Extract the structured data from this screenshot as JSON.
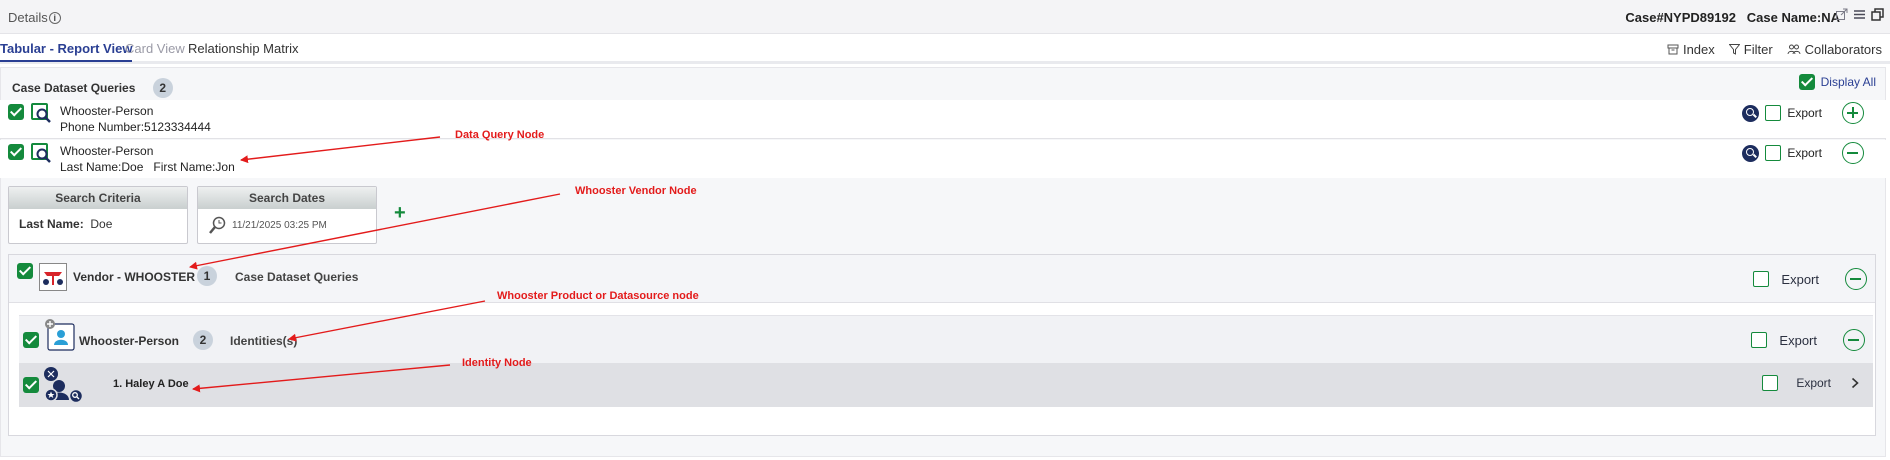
{
  "header": {
    "title": "Details",
    "case_label": "Case#NYPD89192",
    "case_name_label": "Case Name:",
    "case_name_value": "NA"
  },
  "tabs": [
    {
      "label": "Tabular - Report View",
      "state": "active"
    },
    {
      "label": "Card View",
      "state": "disabled"
    },
    {
      "label": "Relationship Matrix",
      "state": "normal"
    }
  ],
  "toolbar": {
    "index_label": "Index",
    "filter_label": "Filter",
    "collaborators_label": "Collaborators"
  },
  "dataset": {
    "title": "Case Dataset Queries",
    "count": "2",
    "display_all_label": "Display All"
  },
  "queries": [
    {
      "name": "Whooster-Person",
      "detail_label": "Phone Number:",
      "detail_value": "5123334444",
      "export_label": "Export"
    },
    {
      "name": "Whooster-Person",
      "detail_label": "Last Name:",
      "detail_value": "Doe",
      "detail2_label": "First Name:",
      "detail2_value": "Jon",
      "export_label": "Export"
    }
  ],
  "search_criteria": {
    "title": "Search Criteria",
    "field_label": "Last Name:",
    "field_value": "Doe"
  },
  "search_dates": {
    "title": "Search Dates",
    "value": "11/21/2025 03:25 PM"
  },
  "vendor": {
    "name": "Vendor - WHOOSTER",
    "count": "1",
    "label": "Case Dataset Queries",
    "export_label": "Export"
  },
  "product": {
    "name": "Whooster-Person",
    "count": "2",
    "label": "Identities(s)",
    "export_label": "Export"
  },
  "identity": {
    "name": "1. Haley A Doe",
    "export_label": "Export"
  },
  "annotations": {
    "data_query_node": "Data Query Node",
    "vendor_node": "Whooster Vendor Node",
    "product_node": "Whooster Product or Datasource node",
    "identity_node": "Identity Node"
  },
  "colors": {
    "accent_green": "#148a3c",
    "tab_active": "#2a3f93",
    "annotation_red": "#e31b1b",
    "icon_navy": "#1d2d5e"
  }
}
